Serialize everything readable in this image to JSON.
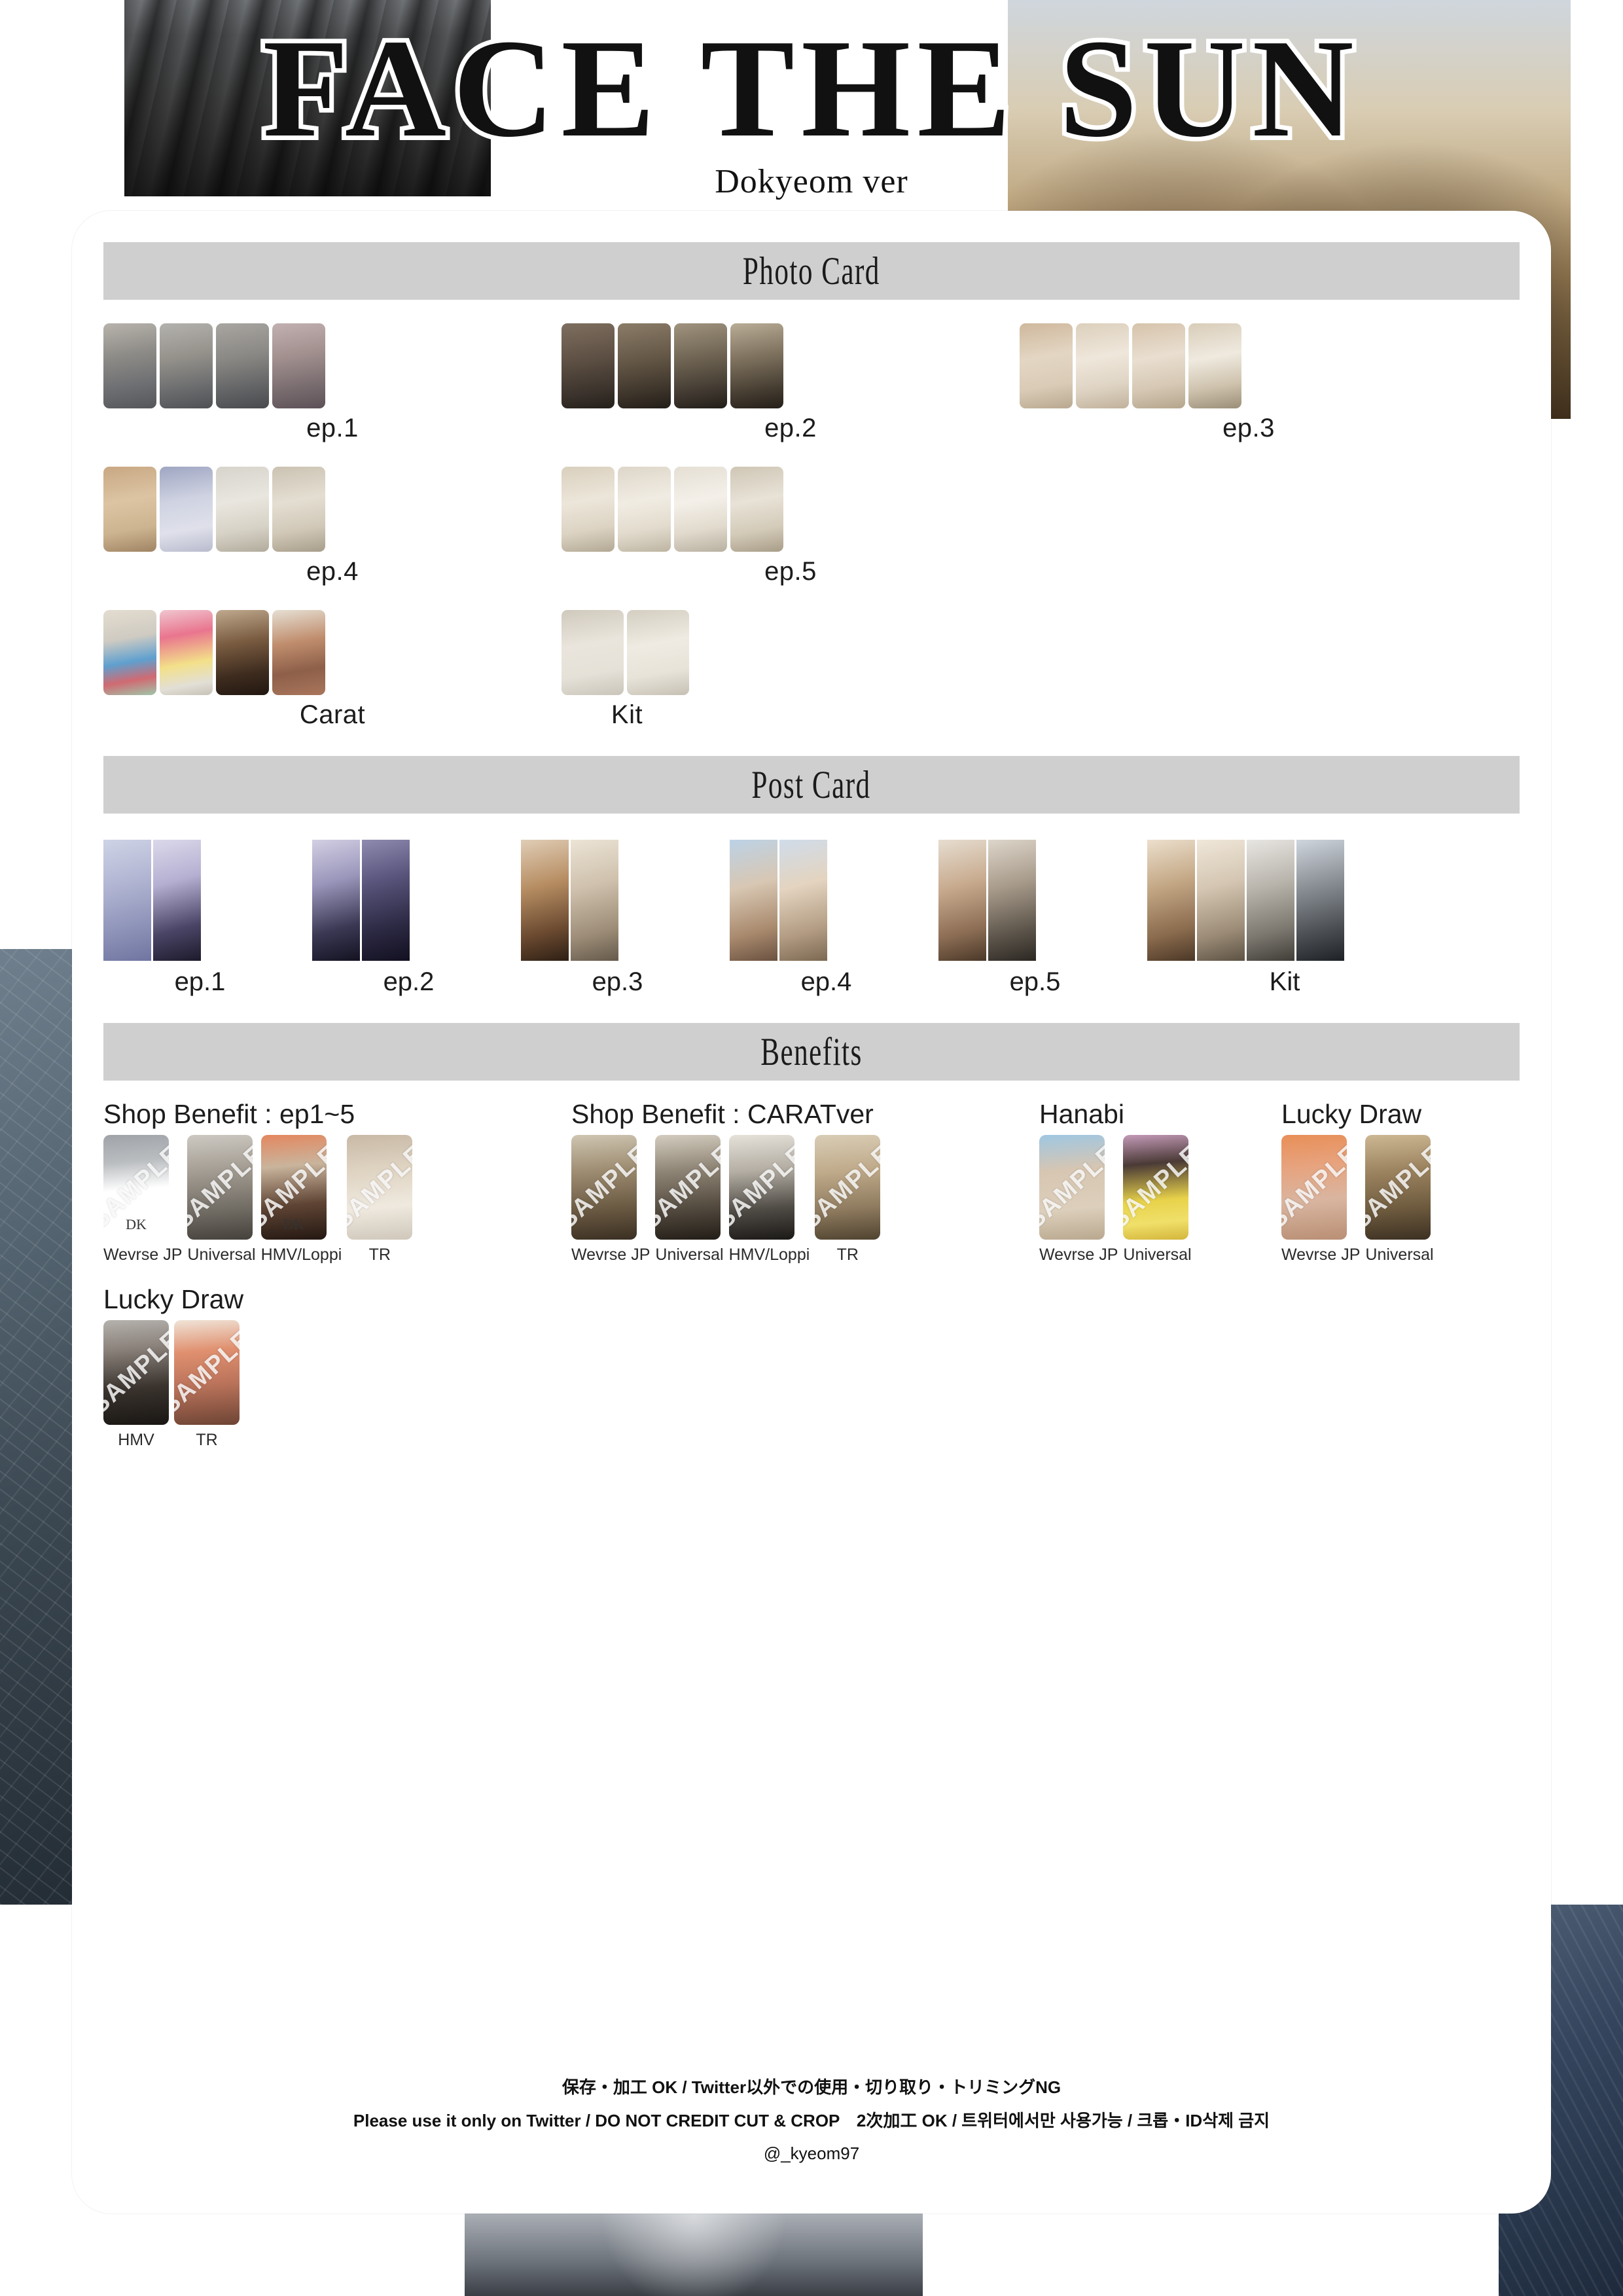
{
  "header": {
    "title": "FACE THE SUN",
    "subtitle": "Dokyeom ver"
  },
  "sections": {
    "photo_card": {
      "heading": "Photo Card",
      "groups": [
        {
          "label": "ep.1",
          "count": 4
        },
        {
          "label": "ep.2",
          "count": 4
        },
        {
          "label": "ep.3",
          "count": 4
        },
        {
          "label": "ep.4",
          "count": 4
        },
        {
          "label": "ep.5",
          "count": 4
        },
        {
          "label": "Carat",
          "count": 4
        },
        {
          "label": "Kit",
          "count": 2
        }
      ]
    },
    "post_card": {
      "heading": "Post Card",
      "groups": [
        {
          "label": "ep.1",
          "count": 2
        },
        {
          "label": "ep.2",
          "count": 2
        },
        {
          "label": "ep.3",
          "count": 2
        },
        {
          "label": "ep.4",
          "count": 2
        },
        {
          "label": "ep.5",
          "count": 2
        },
        {
          "label": "Kit",
          "count": 4
        }
      ]
    },
    "benefits": {
      "heading": "Benefits",
      "blocks": [
        {
          "title": "Shop Benefit : ep1~5",
          "items": [
            {
              "caption": "Wevrse JP",
              "watermark": "SAMPLE",
              "tag": "DK"
            },
            {
              "caption": "Universal",
              "watermark": "SAMPLE",
              "tag": ""
            },
            {
              "caption": "HMV/Loppi",
              "watermark": "SAMPLE",
              "tag": "DK"
            },
            {
              "caption": "TR",
              "watermark": "SAMPLE",
              "tag": ""
            }
          ]
        },
        {
          "title": "Shop Benefit : CARATver",
          "items": [
            {
              "caption": "Wevrse JP",
              "watermark": "SAMPLE",
              "tag": ""
            },
            {
              "caption": "Universal",
              "watermark": "SAMPLE",
              "tag": ""
            },
            {
              "caption": "HMV/Loppi",
              "watermark": "SAMPLE",
              "tag": ""
            },
            {
              "caption": "TR",
              "watermark": "SAMPLE",
              "tag": ""
            }
          ]
        },
        {
          "title": "Hanabi",
          "items": [
            {
              "caption": "Wevrse JP",
              "watermark": "SAMPLE",
              "tag": ""
            },
            {
              "caption": "Universal",
              "watermark": "SAMPLE",
              "tag": ""
            }
          ]
        },
        {
          "title": "Lucky Draw",
          "items": [
            {
              "caption": "Wevrse JP",
              "watermark": "SAMPLE",
              "tag": ""
            },
            {
              "caption": "Universal",
              "watermark": "SAMPLE",
              "tag": ""
            }
          ]
        }
      ],
      "second_row": [
        {
          "title": "Lucky Draw",
          "items": [
            {
              "caption": "HMV",
              "watermark": "SAMPLE",
              "tag": ""
            },
            {
              "caption": "TR",
              "watermark": "SAMPLE",
              "tag": ""
            }
          ]
        }
      ]
    }
  },
  "footer": {
    "line1": "保存・加工 OK / Twitter以外での使用・切り取り・トリミングNG",
    "line2": "Please use it only on Twitter / DO NOT CREDIT CUT & CROP　2次加工 OK / 트위터에서만 사용가능 / 크롭・ID삭제 금지",
    "line3": "@_kyeom97"
  },
  "colors": {
    "section_bar": "#cfcfcf",
    "panel": "#ffffff",
    "text": "#1c1c1c"
  }
}
